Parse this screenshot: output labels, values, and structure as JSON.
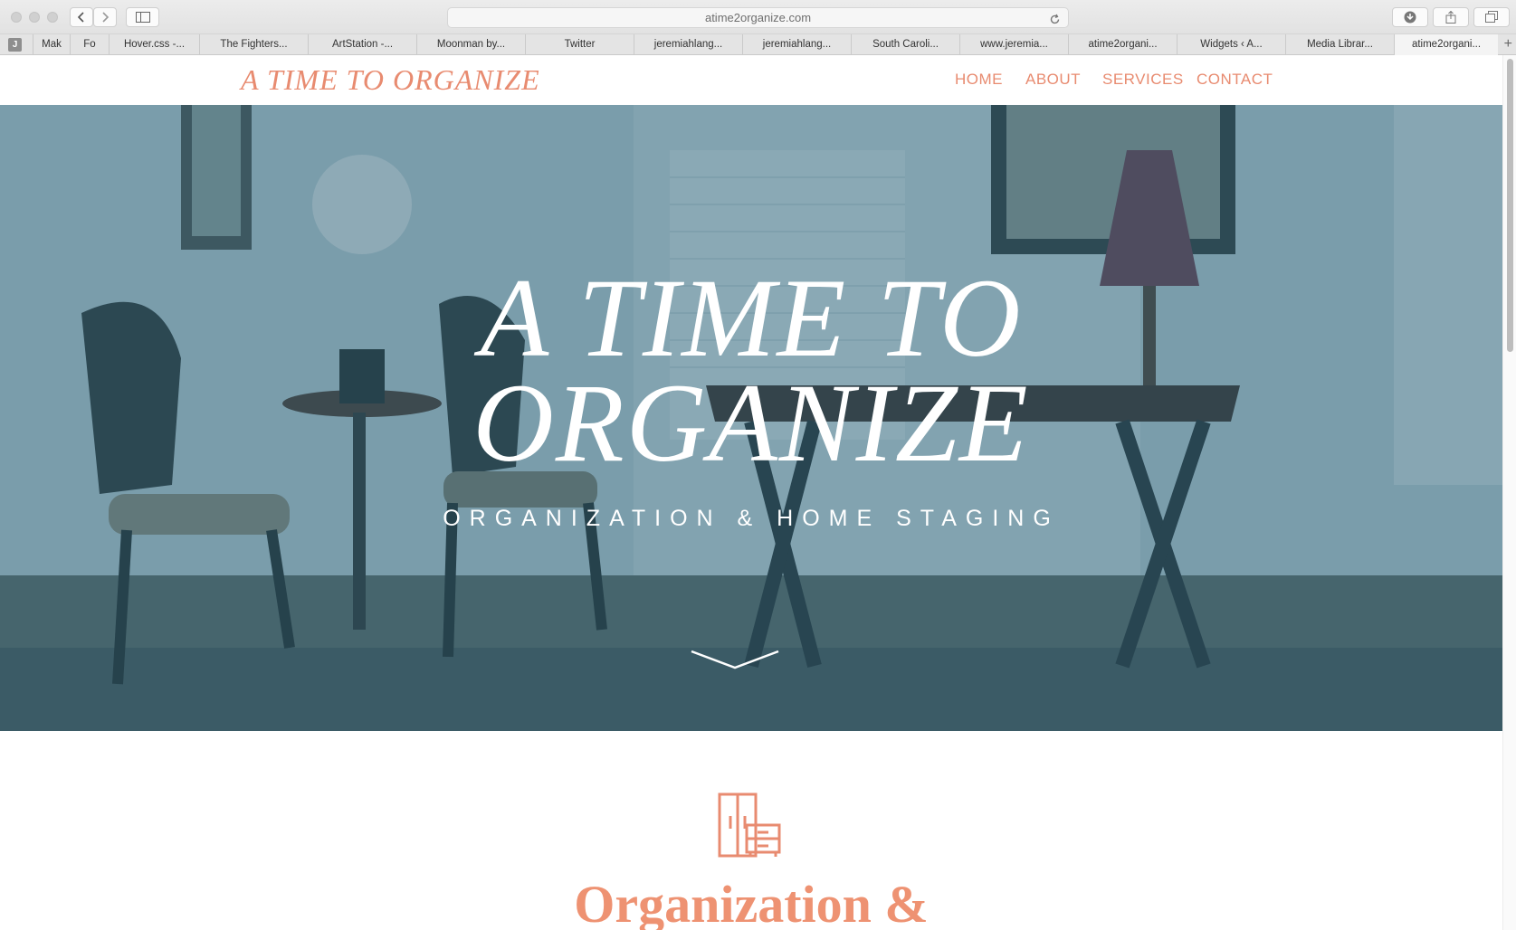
{
  "browser": {
    "url": "atime2organize.com",
    "tabs": [
      {
        "label": "Mak"
      },
      {
        "label": "Fo"
      },
      {
        "label": "Hover.css -..."
      },
      {
        "label": "The Fighters..."
      },
      {
        "label": "ArtStation -..."
      },
      {
        "label": "Moonman by..."
      },
      {
        "label": "Twitter"
      },
      {
        "label": "jeremiahlang..."
      },
      {
        "label": "jeremiahlang..."
      },
      {
        "label": "South Caroli..."
      },
      {
        "label": "www.jeremia..."
      },
      {
        "label": "atime2organi..."
      },
      {
        "label": "Widgets ‹ A..."
      },
      {
        "label": "Media Librar..."
      },
      {
        "label": "atime2organi..."
      }
    ],
    "favicon_letter": "J",
    "new_tab_glyph": "+"
  },
  "site": {
    "logo": "A TIME TO ORGANIZE",
    "nav": [
      "HOME",
      "ABOUT",
      "SERVICES",
      "CONTACT"
    ],
    "hero": {
      "title_line1": "A TIME TO",
      "title_line2": "ORGANIZE",
      "subtitle": "ORGANIZATION & HOME STAGING"
    },
    "section": {
      "icon": "furniture-icon",
      "title": "Organization &"
    }
  },
  "colors": {
    "accent": "#e88b70",
    "hero_overlay": "#3f6678",
    "hero_text": "#ffffff"
  }
}
